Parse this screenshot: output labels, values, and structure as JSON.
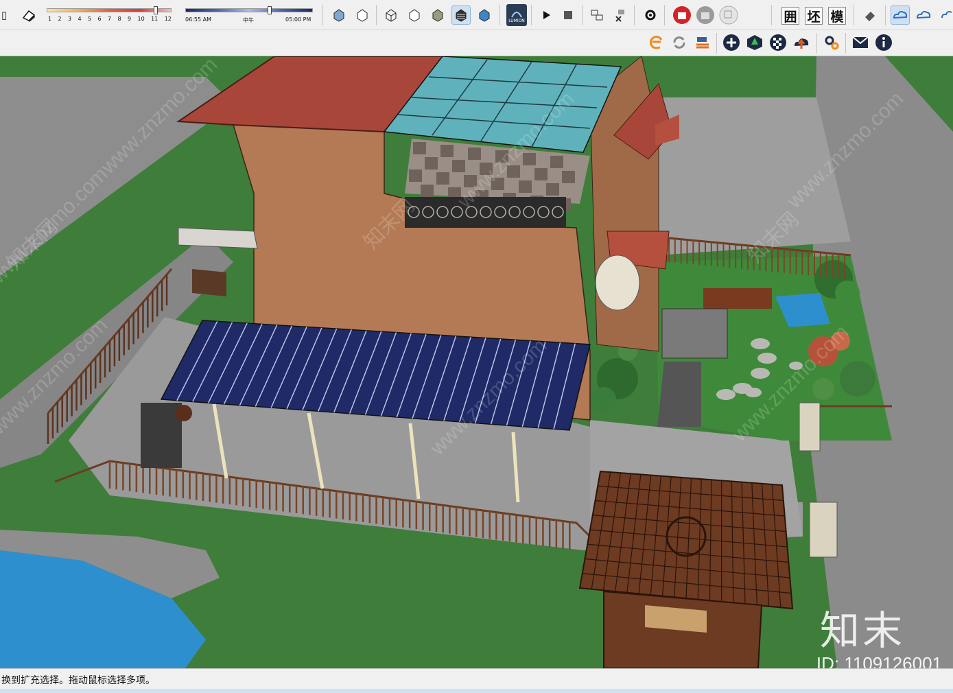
{
  "toolbar_top": {
    "month_ticks": [
      "1",
      "2",
      "3",
      "4",
      "5",
      "6",
      "7",
      "8",
      "9",
      "10",
      "11",
      "12"
    ],
    "time_start": "06:55 AM",
    "time_mid": "中午",
    "time_end": "05:00 PM",
    "month_value": 11,
    "lumion_label": "LUMION",
    "cn_button_1": "囲",
    "cn_button_2": "坯",
    "cn_button_3": "模"
  },
  "status_bar": {
    "text": "换到扩充选择。拖动鼠标选择多项。"
  },
  "watermark": {
    "logo": "知末",
    "id": "ID: 1109126001",
    "diagonal_text": "www.znzmo.com",
    "diagonal_cn": "知末网"
  },
  "colors": {
    "grass": "#3f7d3a",
    "water": "#2e8fcf",
    "wall": "#b47a55",
    "roof": "#a9463a",
    "glass": "#5fb2bb",
    "solar": "#1f2a66",
    "paving": "#9b9b9b",
    "fence": "#6b3c22"
  }
}
